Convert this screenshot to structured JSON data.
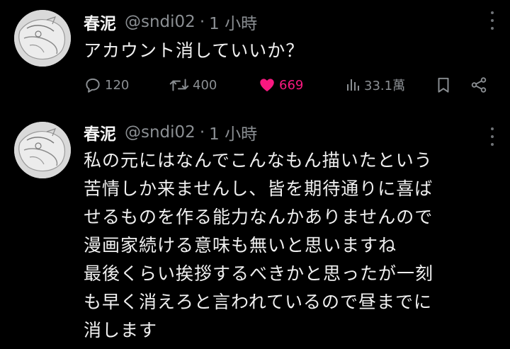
{
  "posts": [
    {
      "author_name": "春泥",
      "author_handle": "@sndi02",
      "separator": "·",
      "time": "1 小時",
      "text": "アカウント消していいか？",
      "stats": {
        "replies": "120",
        "reposts": "400",
        "likes": "669",
        "views": "33.1萬"
      },
      "liked": true
    },
    {
      "author_name": "春泥",
      "author_handle": "@sndi02",
      "separator": "·",
      "time": "1 小時",
      "text": "私の元にはなんでこんなもん描いたという\n苦情しか来ませんし、皆を期待通りに喜ば\nせるものを作る能力なんかありませんので\n漫画家続ける意味も無いと思いますね\n最後くらい挨拶するべきかと思ったが一刻\nも早く消えろと言われているので昼までに\n消します"
    }
  ],
  "icons": {
    "reply": "reply-icon",
    "repost": "repost-icon",
    "like": "heart-icon",
    "views": "views-icon",
    "bookmark": "bookmark-icon",
    "share": "share-icon",
    "more": "more-icon"
  },
  "colors": {
    "background": "#000000",
    "text": "#f0f0f0",
    "muted": "#8b8f93",
    "like": "#f91880"
  }
}
